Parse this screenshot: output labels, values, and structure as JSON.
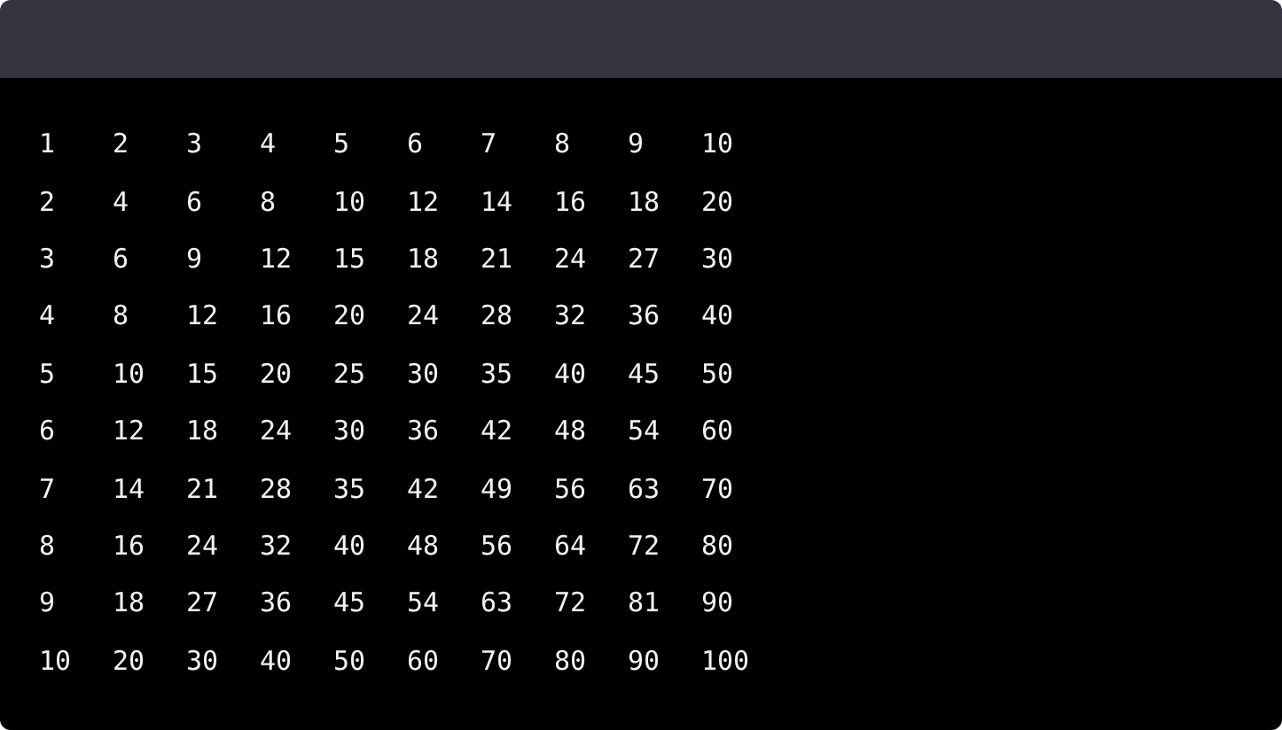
{
  "rows": [
    [
      "1",
      "2",
      "3",
      "4",
      "5",
      "6",
      "7",
      "8",
      "9",
      "10"
    ],
    [
      "2",
      "4",
      "6",
      "8",
      "10",
      "12",
      "14",
      "16",
      "18",
      "20"
    ],
    [
      "3",
      "6",
      "9",
      "12",
      "15",
      "18",
      "21",
      "24",
      "27",
      "30"
    ],
    [
      "4",
      "8",
      "12",
      "16",
      "20",
      "24",
      "28",
      "32",
      "36",
      "40"
    ],
    [
      "5",
      "10",
      "15",
      "20",
      "25",
      "30",
      "35",
      "40",
      "45",
      "50"
    ],
    [
      "6",
      "12",
      "18",
      "24",
      "30",
      "36",
      "42",
      "48",
      "54",
      "60"
    ],
    [
      "7",
      "14",
      "21",
      "28",
      "35",
      "42",
      "49",
      "56",
      "63",
      "70"
    ],
    [
      "8",
      "16",
      "24",
      "32",
      "40",
      "48",
      "56",
      "64",
      "72",
      "80"
    ],
    [
      "9",
      "18",
      "27",
      "36",
      "45",
      "54",
      "63",
      "72",
      "81",
      "90"
    ],
    [
      "10",
      "20",
      "30",
      "40",
      "50",
      "60",
      "70",
      "80",
      "90",
      "100"
    ]
  ]
}
